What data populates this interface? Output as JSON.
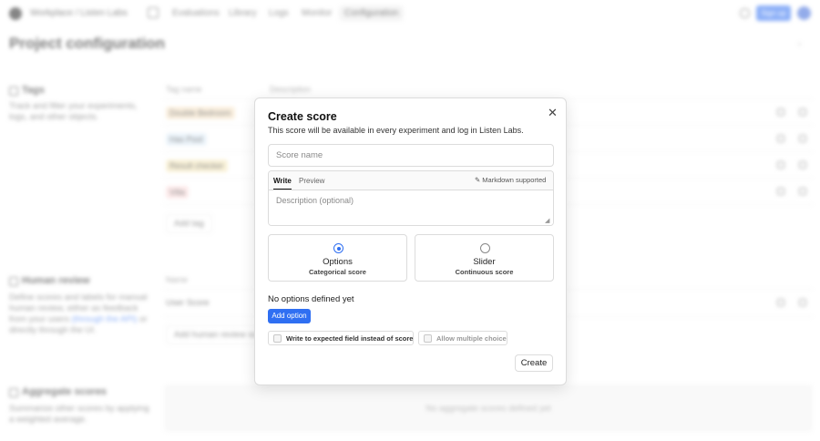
{
  "topbar": {
    "org": "Workplace / Listen Labs",
    "nav": [
      "Evaluations",
      "Library",
      "Logs",
      "Monitor",
      "Configuration"
    ],
    "signup_label": "Sign up"
  },
  "page": {
    "title": "Project configuration"
  },
  "tags_section": {
    "title": "Tags",
    "description": "Track and filter your experiments, logs, and other objects.",
    "col_tag_name": "Tag name",
    "col_description": "Description",
    "tags": [
      {
        "name": "Double Bedroom",
        "color": "#f7e3c4"
      },
      {
        "name": "Has Pool",
        "color": "#dcebf7"
      },
      {
        "name": "Result checker",
        "color": "#f5e7b8"
      },
      {
        "name": "Villa",
        "color": "#fbdada"
      }
    ],
    "add_tag_label": "Add tag"
  },
  "human_review": {
    "title": "Human review",
    "description_a": "Define scores and labels for manual human review, either as feedback from your users ",
    "link": "(through the API)",
    "description_b": " or directly through the UI.",
    "col_name": "Name",
    "row": "User Score",
    "add_label": "Add human review score"
  },
  "aggregate": {
    "title": "Aggregate scores",
    "description": "Summarize other scores by applying a weighted average.",
    "empty": "No aggregate scores defined yet"
  },
  "modal": {
    "title": "Create score",
    "subtitle": "This score will be available in every experiment and log in Listen Labs.",
    "name_placeholder": "Score name",
    "tab_write": "Write",
    "tab_preview": "Preview",
    "markdown_note": "Markdown supported",
    "description_placeholder": "Description (optional)",
    "types": [
      {
        "title": "Options",
        "subtitle": "Categorical score",
        "selected": true
      },
      {
        "title": "Slider",
        "subtitle": "Continuous score",
        "selected": false
      }
    ],
    "no_options": "No options defined yet",
    "add_option": "Add option",
    "checkbox_expected": "Write to expected field instead of score",
    "checkbox_multiple": "Allow multiple choice",
    "create_label": "Create"
  },
  "colors": {
    "accent": "#2f6ff2"
  }
}
